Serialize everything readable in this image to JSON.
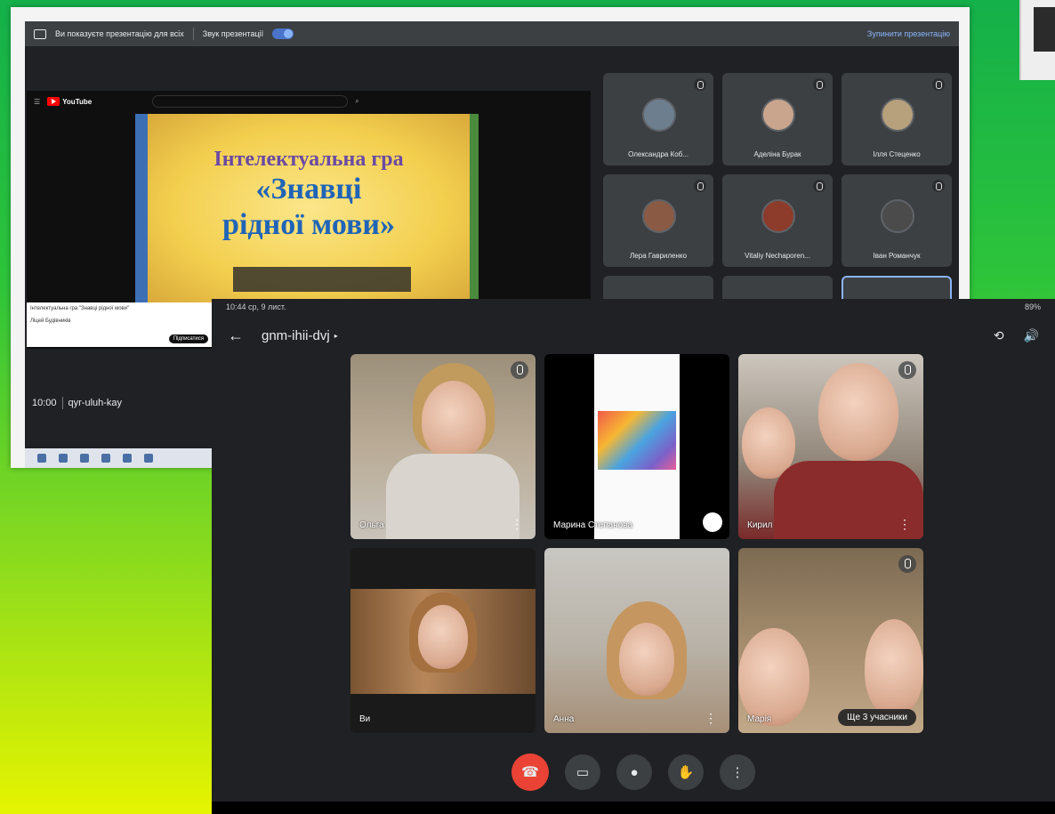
{
  "desktop": {
    "present_bar": {
      "presenting_text": "Ви показуєте презентацію для всіх",
      "toggle_label": "Звук презентації",
      "stop_label": "Зупинити презентацію"
    },
    "youtube": {
      "logo": "YouTube",
      "slide_title_1": "Інтелектуальна гра",
      "slide_title_2": "«Знавці",
      "slide_title_3": "рідної мови»",
      "below_title": "Інтелектуальна гра \"Знавці рідної мови\"",
      "channel": "Ліцей Будівників",
      "subscribe": "Підписатися"
    },
    "meeting_footer": {
      "time": "10:00",
      "code": "qyr-uluh-kay"
    },
    "tiles": [
      {
        "name": "Олександра Коб..."
      },
      {
        "name": "Аделіна Бурак"
      },
      {
        "name": "Ілля Стеценко"
      },
      {
        "name": "Лера Гавриленко"
      },
      {
        "name": "Vitaliy Nechaporen..."
      },
      {
        "name": "Іван Романчук"
      }
    ]
  },
  "mobile": {
    "status": {
      "time_date": "10:44  ср, 9 лист.",
      "battery": "89%"
    },
    "meeting_code": "gnm-ihii-dvj",
    "tiles": [
      {
        "name": "Ольга"
      },
      {
        "name": "Марина Степанова"
      },
      {
        "name": "Кирил"
      },
      {
        "name": "Ви"
      },
      {
        "name": "Анна"
      },
      {
        "name": "Марія"
      }
    ],
    "more_participants": "Ще 3 учасники"
  },
  "colors": {
    "end_call": "#ea4335",
    "meet_dark": "#202124",
    "tile_bg": "#3c4043",
    "accent_blue": "#8ab4f8"
  }
}
